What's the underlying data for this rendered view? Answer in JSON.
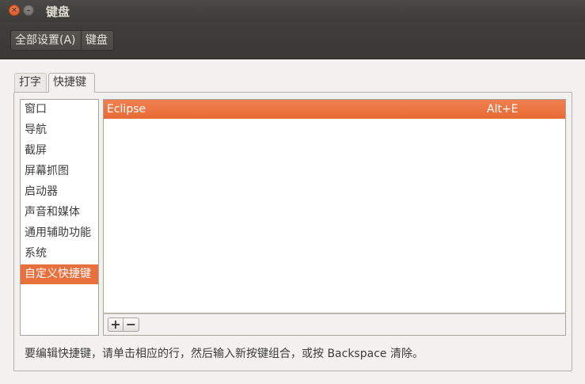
{
  "window": {
    "title": "键盘",
    "close_glyph": "✕",
    "minimize_glyph": "–"
  },
  "breadcrumb": {
    "all_settings": "全部设置(A)",
    "current": "键盘"
  },
  "tabs": [
    {
      "label": "打字",
      "active": false
    },
    {
      "label": "快捷键",
      "active": true
    }
  ],
  "categories": [
    {
      "label": "窗口",
      "selected": false
    },
    {
      "label": "导航",
      "selected": false
    },
    {
      "label": "截屏",
      "selected": false
    },
    {
      "label": "屏幕抓图",
      "selected": false
    },
    {
      "label": "启动器",
      "selected": false
    },
    {
      "label": "声音和媒体",
      "selected": false
    },
    {
      "label": "通用辅助功能",
      "selected": false
    },
    {
      "label": "系统",
      "selected": false
    },
    {
      "label": "自定义快捷键",
      "selected": true
    }
  ],
  "shortcuts": [
    {
      "name": "Eclipse",
      "accel": "Alt+E",
      "selected": true
    }
  ],
  "list_toolbar": {
    "add": "+",
    "remove": "−"
  },
  "hint": "要编辑快捷键，请单击相应的行，然后输入新按键组合，或按 Backspace 清除。",
  "colors": {
    "accent": "#e8703d",
    "titlebar": "#3c3b37",
    "background": "#f2f1f0"
  }
}
